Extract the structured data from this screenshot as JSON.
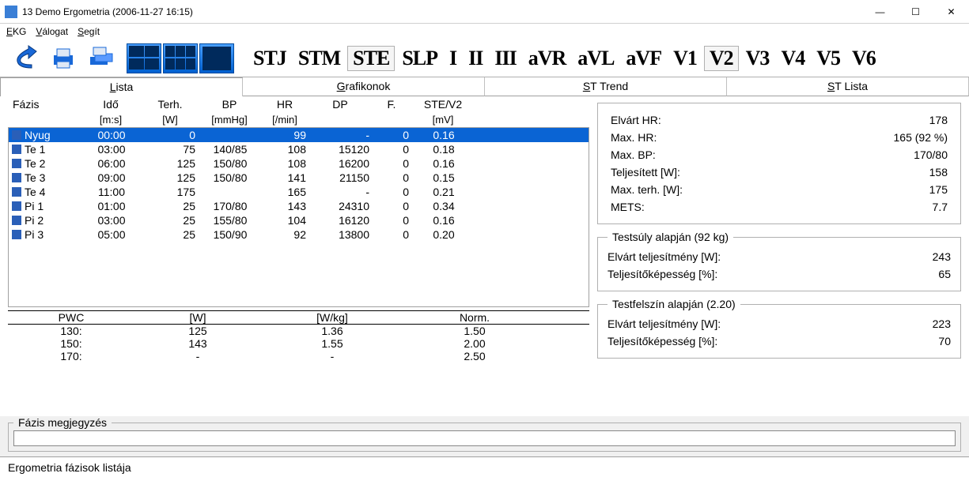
{
  "window": {
    "title": "13 Demo Ergometria (2006-11-27 16:15)"
  },
  "menu": {
    "ekg": "EKG",
    "valogat": "Válogat",
    "segit": "Segít"
  },
  "leads": [
    "STJ",
    "STM",
    "STE",
    "SLP",
    "I",
    "II",
    "III",
    "aVR",
    "aVL",
    "aVF",
    "V1",
    "V2",
    "V3",
    "V4",
    "V5",
    "V6"
  ],
  "leads_pressed": [
    "STE",
    "V2"
  ],
  "tabs": {
    "lista": "Lista",
    "grafikonok": "Grafikonok",
    "sttrend": "ST Trend",
    "stlista": "ST Lista",
    "active": "lista"
  },
  "table": {
    "headers": {
      "fazis": "Fázis",
      "ido": "Idő",
      "ido_unit": "[m:s]",
      "terh": "Terh.",
      "terh_unit": "[W]",
      "bp": "BP",
      "bp_unit": "[mmHg]",
      "hr": "HR",
      "hr_unit": "[/min]",
      "dp": "DP",
      "f": "F.",
      "ste": "STE/V2",
      "ste_unit": "[mV]"
    },
    "rows": [
      {
        "sel": true,
        "ph": "Nyug",
        "ido": "00:00",
        "terh": "0",
        "bp": "",
        "hr": "99",
        "dp": "-",
        "f": "0",
        "ste": "0.16"
      },
      {
        "ph": "Te 1",
        "ido": "03:00",
        "terh": "75",
        "bp": "140/85",
        "hr": "108",
        "dp": "15120",
        "f": "0",
        "ste": "0.18"
      },
      {
        "ph": "Te 2",
        "ido": "06:00",
        "terh": "125",
        "bp": "150/80",
        "hr": "108",
        "dp": "16200",
        "f": "0",
        "ste": "0.16"
      },
      {
        "ph": "Te 3",
        "ido": "09:00",
        "terh": "125",
        "bp": "150/80",
        "hr": "141",
        "dp": "21150",
        "f": "0",
        "ste": "0.15"
      },
      {
        "ph": "Te 4",
        "ido": "11:00",
        "terh": "175",
        "bp": "",
        "hr": "165",
        "dp": "-",
        "f": "0",
        "ste": "0.21"
      },
      {
        "ph": "Pi 1",
        "ido": "01:00",
        "terh": "25",
        "bp": "170/80",
        "hr": "143",
        "dp": "24310",
        "f": "0",
        "ste": "0.34"
      },
      {
        "ph": "Pi 2",
        "ido": "03:00",
        "terh": "25",
        "bp": "155/80",
        "hr": "104",
        "dp": "16120",
        "f": "0",
        "ste": "0.16"
      },
      {
        "ph": "Pi 3",
        "ido": "05:00",
        "terh": "25",
        "bp": "150/90",
        "hr": "92",
        "dp": "13800",
        "f": "0",
        "ste": "0.20"
      }
    ]
  },
  "pwc": {
    "headers": {
      "c0": "PWC",
      "c1": "[W]",
      "c2": "[W/kg]",
      "c3": "Norm."
    },
    "rows": [
      {
        "c0": "130:",
        "c1": "125",
        "c2": "1.36",
        "c3": "1.50"
      },
      {
        "c0": "150:",
        "c1": "143",
        "c2": "1.55",
        "c3": "2.00"
      },
      {
        "c0": "170:",
        "c1": "-",
        "c2": "-",
        "c3": "2.50"
      }
    ]
  },
  "summary": {
    "elvart_hr_l": "Elvárt HR:",
    "elvart_hr_v": "178",
    "max_hr_l": "Max. HR:",
    "max_hr_v": "165 (92 %)",
    "max_bp_l": "Max. BP:",
    "max_bp_v": "170/80",
    "telj_l": "Teljesített [W]:",
    "telj_v": "158",
    "max_terh_l": "Max. terh. [W]:",
    "max_terh_v": "175",
    "mets_l": "METS:",
    "mets_v": "7.7"
  },
  "weight_group": {
    "legend": "Testsúly alapján   (92 kg)",
    "elvart_l": "Elvárt teljesítmény [W]:",
    "elvart_v": "243",
    "kepes_l": "Teljesítőképesség [%]:",
    "kepes_v": "65"
  },
  "surface_group": {
    "legend": "Testfelszín alapján   (2.20)",
    "elvart_l": "Elvárt teljesítmény [W]:",
    "elvart_v": "223",
    "kepes_l": "Teljesítőképesség [%]:",
    "kepes_v": "70"
  },
  "phase_note": {
    "legend": "Fázis megjegyzés",
    "value": ""
  },
  "status": "Ergometria fázisok listája"
}
